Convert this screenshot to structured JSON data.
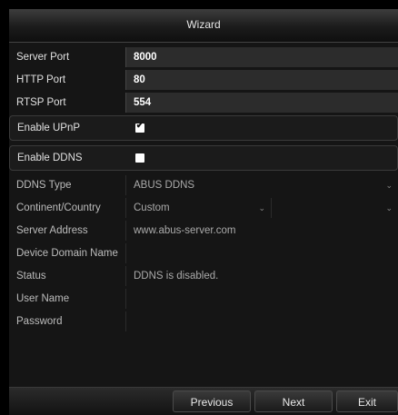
{
  "window": {
    "title": "Wizard"
  },
  "fields": {
    "server_port": {
      "label": "Server Port",
      "value": "8000"
    },
    "http_port": {
      "label": "HTTP Port",
      "value": "80"
    },
    "rtsp_port": {
      "label": "RTSP Port",
      "value": "554"
    },
    "enable_upnp": {
      "label": "Enable UPnP",
      "checked": true
    },
    "enable_ddns": {
      "label": "Enable DDNS",
      "checked": false
    },
    "ddns_type": {
      "label": "DDNS Type",
      "value": "ABUS DDNS"
    },
    "continent_country": {
      "label": "Continent/Country",
      "value": "Custom",
      "second_value": ""
    },
    "server_address": {
      "label": "Server Address",
      "value": "www.abus-server.com"
    },
    "device_domain_name": {
      "label": "Device Domain Name",
      "value": ""
    },
    "status": {
      "label": "Status",
      "value": "DDNS is disabled."
    },
    "user_name": {
      "label": "User Name",
      "value": ""
    },
    "password": {
      "label": "Password",
      "value": ""
    }
  },
  "footer": {
    "previous_label": "Previous",
    "next_label": "Next",
    "exit_label": "Exit"
  },
  "icons": {
    "checkmark": "check-icon",
    "dropdown": "chevron-down-icon"
  }
}
